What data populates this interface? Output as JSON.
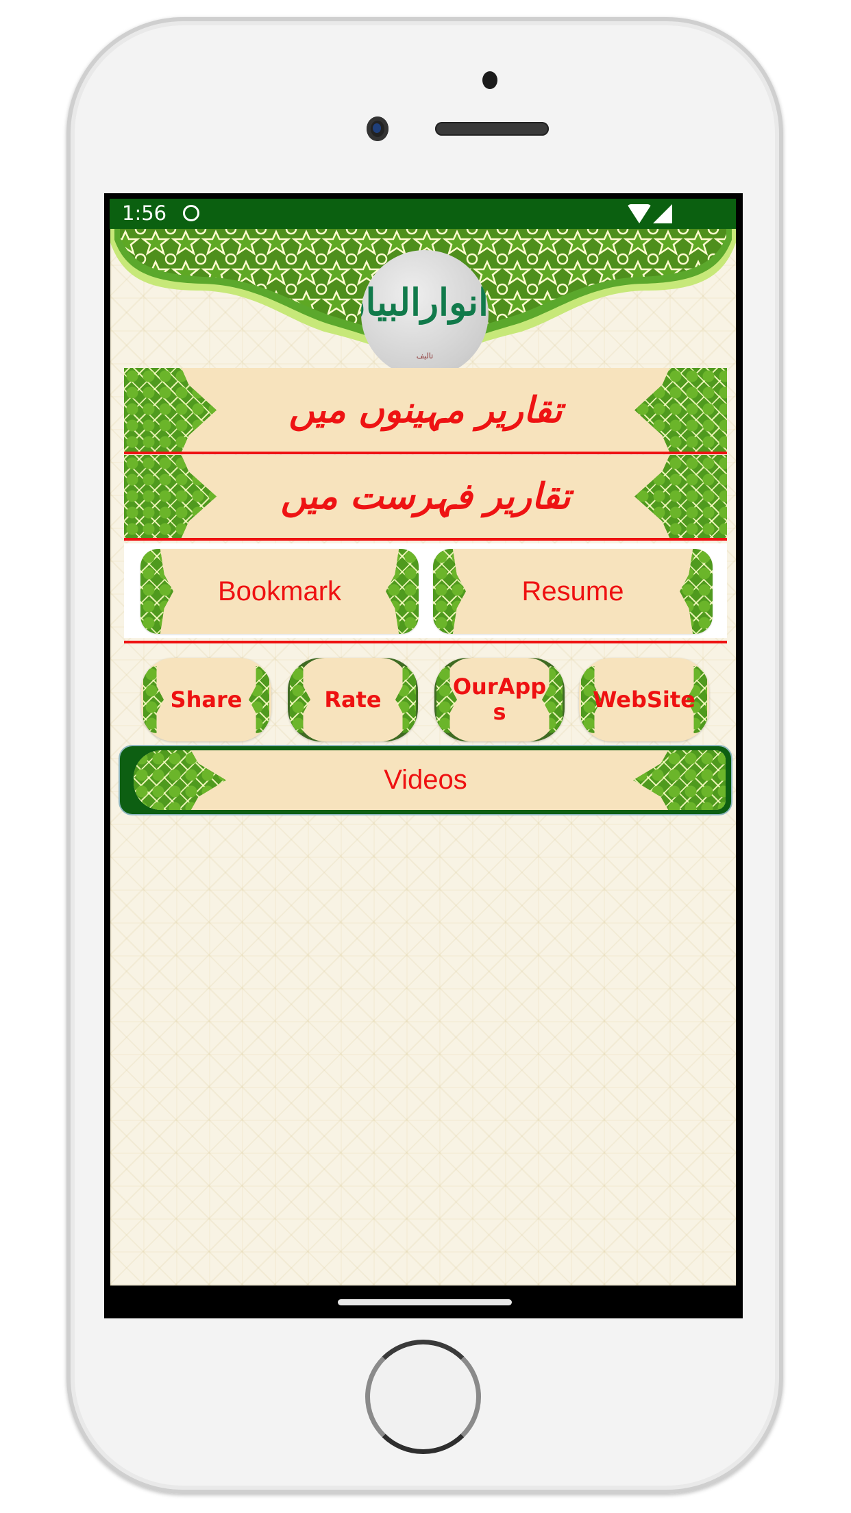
{
  "status_bar": {
    "time": "1:56",
    "icons": [
      "notification-icon",
      "wifi-icon",
      "signal-icon"
    ]
  },
  "header": {
    "logo_title": "انوارالبیان",
    "logo_subtitle": "تالیف"
  },
  "menu": {
    "banners": [
      {
        "label": "تقاریر مہینوں میں"
      },
      {
        "label": "تقاریر فہرست میں"
      }
    ],
    "pill_buttons": [
      {
        "label": "Bookmark"
      },
      {
        "label": "Resume"
      }
    ],
    "small_buttons": [
      {
        "label": "Share"
      },
      {
        "label": "Rate"
      },
      {
        "label": "OurApps"
      },
      {
        "label": "WebSite"
      }
    ],
    "videos_button": {
      "label": "Videos"
    }
  },
  "colors": {
    "status_bar": "#0b6010",
    "button_text": "#ee1111",
    "divider": "#ee1111",
    "ornament_green": "#4f9a1e",
    "button_fill": "#f7e3bd",
    "videos_border": "#0d5f12",
    "logo_text": "#117a4b"
  }
}
